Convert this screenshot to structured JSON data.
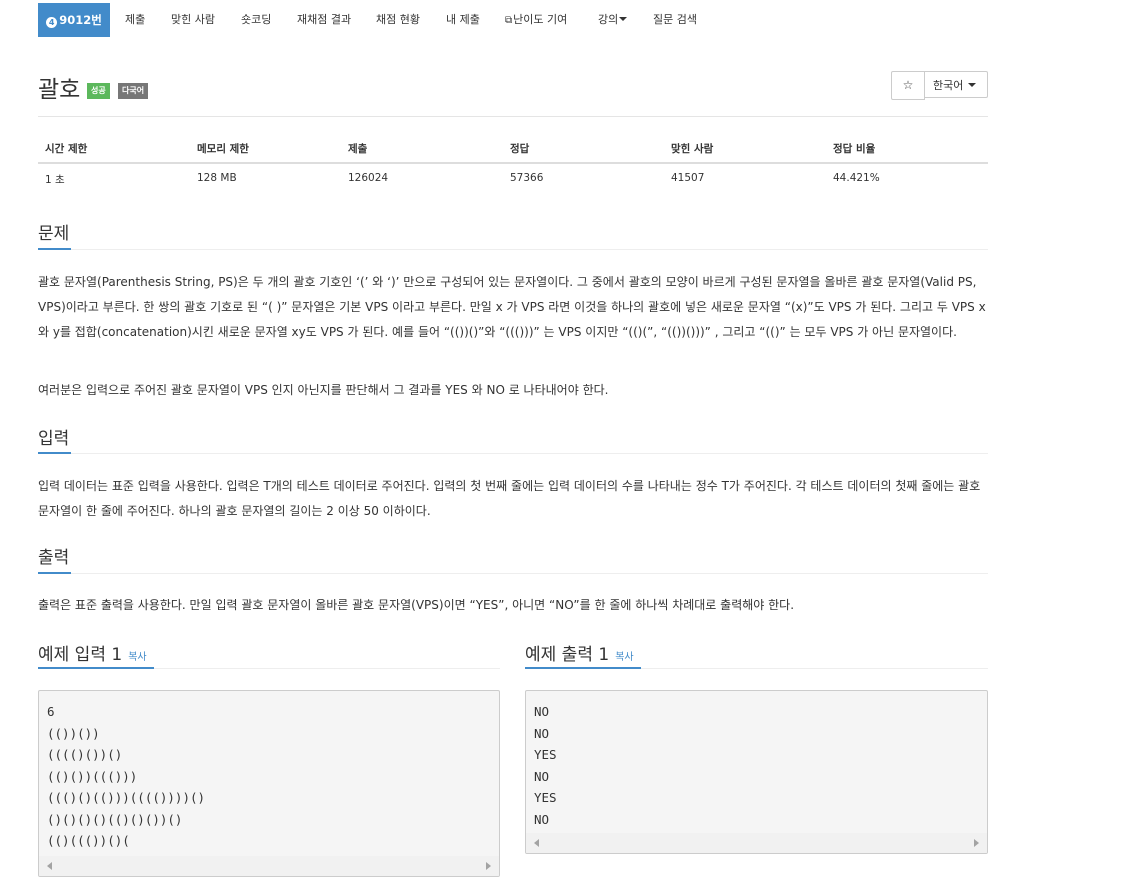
{
  "nav": {
    "brand_icon": "4",
    "brand": "9012번",
    "items": [
      "제출",
      "맞힌 사람",
      "숏코딩",
      "재채점 결과",
      "채점 현황",
      "내 제출",
      "난이도 기여",
      "강의",
      "질문 검색"
    ]
  },
  "problem": {
    "title": "괄호",
    "badges": [
      "성공",
      "다국어"
    ],
    "star": "☆",
    "language": "한국어"
  },
  "info_table": {
    "headers": [
      "시간 제한",
      "메모리 제한",
      "제출",
      "정답",
      "맞힌 사람",
      "정답 비율"
    ],
    "values": [
      "1 초",
      "128 MB",
      "126024",
      "57366",
      "41507",
      "44.421%"
    ]
  },
  "sections": {
    "problem_heading": "문제",
    "problem_p1": "괄호 문자열(Parenthesis String, PS)은 두 개의 괄호 기호인 ‘(’ 와 ‘)’ 만으로 구성되어 있는 문자열이다. 그 중에서 괄호의 모양이 바르게 구성된 문자열을 올바른 괄호 문자열(Valid PS, VPS)이라고 부른다. 한 쌍의 괄호 기호로 된 “( )” 문자열은 기본 VPS 이라고 부른다. 만일 x 가 VPS 라면 이것을 하나의 괄호에 넣은 새로운 문자열 “(x)”도 VPS 가 된다. 그리고 두 VPS x 와 y를 접합(concatenation)시킨 새로운 문자열 xy도 VPS 가 된다. 예를 들어 “(())()”와 “((()))” 는 VPS 이지만 “(()(”, “(())()))” , 그리고 “(()” 는 모두 VPS 가 아닌 문자열이다.",
    "problem_p2": "여러분은 입력으로 주어진 괄호 문자열이 VPS 인지 아닌지를 판단해서 그 결과를 YES 와 NO 로 나타내어야 한다.",
    "input_heading": "입력",
    "input_p": "입력 데이터는 표준 입력을 사용한다. 입력은 T개의 테스트 데이터로 주어진다. 입력의 첫 번째 줄에는 입력 데이터의 수를 나타내는 정수 T가 주어진다. 각 테스트 데이터의 첫째 줄에는 괄호 문자열이 한 줄에 주어진다. 하나의 괄호 문자열의 길이는 2 이상 50 이하이다.",
    "output_heading": "출력",
    "output_p": "출력은 표준 출력을 사용한다. 만일 입력 괄호 문자열이 올바른 괄호 문자열(VPS)이면 “YES”, 아니면 “NO”를 한 줄에 하나씩 차례대로 출력해야 한다."
  },
  "samples": {
    "input_heading": "예제 입력 1",
    "output_heading": "예제 출력 1",
    "copy": "복사",
    "input_text": "6\n(())())\n(((()())()\n(()())((()))\n((()()(()))(((())))()\n()()()()(()()())()\n(()((())()(",
    "output_text": "NO\nNO\nYES\nNO\nYES\nNO"
  }
}
